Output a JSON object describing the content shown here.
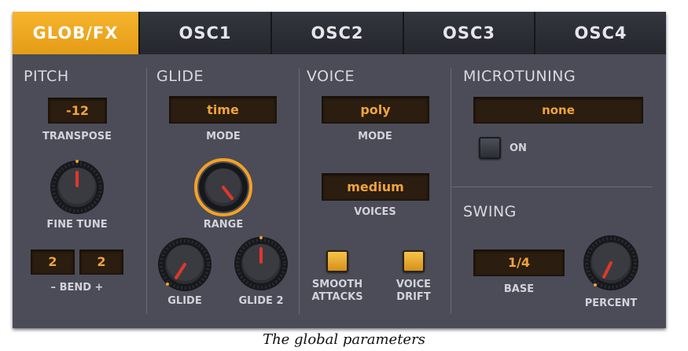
{
  "tabs": [
    "GLOB/FX",
    "OSC1",
    "OSC2",
    "OSC3",
    "OSC4"
  ],
  "active_tab": "GLOB/FX",
  "pitch": {
    "title": "PITCH",
    "transpose_value": "-12",
    "transpose_label": "TRANSPOSE",
    "fine_tune_label": "FINE TUNE",
    "bend_down": "2",
    "bend_up": "2",
    "bend_label": "– BEND +"
  },
  "glide": {
    "title": "GLIDE",
    "mode_value": "time",
    "mode_label": "MODE",
    "range_label": "RANGE",
    "glide_label": "GLIDE",
    "glide2_label": "GLIDE 2"
  },
  "voice": {
    "title": "VOICE",
    "mode_value": "poly",
    "mode_label": "MODE",
    "voices_value": "medium",
    "voices_label": "VOICES",
    "smooth_attacks_label_1": "SMOOTH",
    "smooth_attacks_label_2": "ATTACKS",
    "smooth_attacks_on": true,
    "voice_drift_label_1": "VOICE",
    "voice_drift_label_2": "DRIFT",
    "voice_drift_on": true
  },
  "microtuning": {
    "title": "MICROTUNING",
    "value": "none",
    "on_label": "ON",
    "on_state": false
  },
  "swing": {
    "title": "SWING",
    "base_value": "1/4",
    "base_label": "BASE",
    "percent_label": "PERCENT"
  },
  "caption": "The global parameters",
  "colors": {
    "accent": "#f0a22c",
    "panel": "#4b4c57",
    "display_bg": "#2b1d10",
    "display_text": "#f0a33c",
    "knob_indicator": "#e0372c"
  }
}
